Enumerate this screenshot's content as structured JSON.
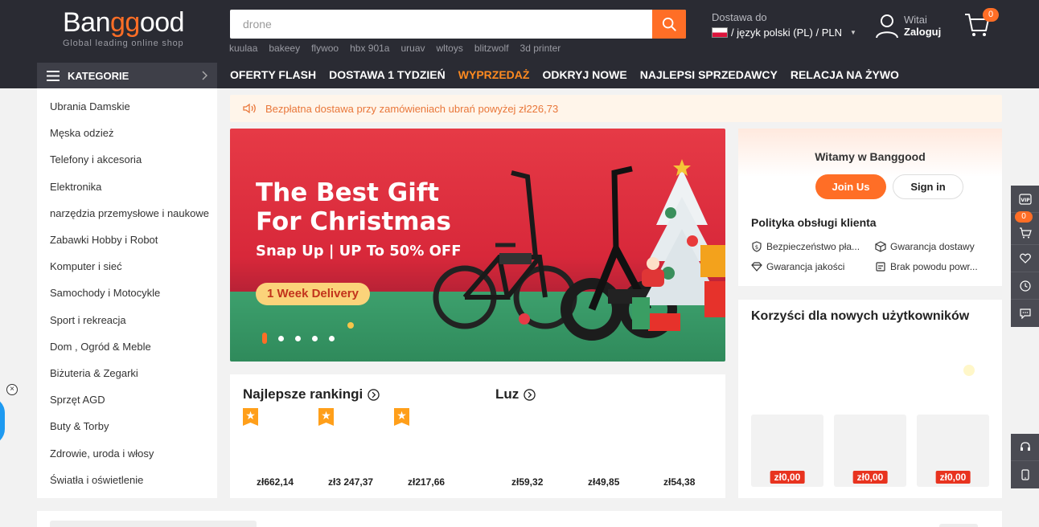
{
  "colors": {
    "brand": "#ff6e26",
    "header_bg": "#2a2b33",
    "price_tag": "#e8331f"
  },
  "logo": {
    "main_prefix": "Ban",
    "main_accent": "gg",
    "main_suffix": "ood",
    "tagline": "Global leading online shop"
  },
  "search": {
    "placeholder": "drone",
    "button_icon": "search-icon"
  },
  "hot_words": [
    "kuulaa",
    "bakeey",
    "flywoo",
    "hbx 901a",
    "uruav",
    "wltoys",
    "blitzwolf",
    "3d printer"
  ],
  "shipping": {
    "label": "Dostawa do",
    "value": "/ język polski (PL) / PLN"
  },
  "account": {
    "greeting": "Witai",
    "login": "Zaloguj"
  },
  "cart": {
    "count": "0"
  },
  "categories_button": "KATEGORIE",
  "nav": [
    "OFERTY FLASH",
    "DOSTAWA 1 TYDZIEŃ",
    "WYPRZEDAŻ",
    "ODKRYJ NOWE",
    "NAJLEPSI SPRZEDAWCY",
    "RELACJA NA ŻYWO"
  ],
  "categories": [
    "Ubrania Damskie",
    "Męska odzież",
    "Telefony i akcesoria",
    "Elektronika",
    "narzędzia przemysłowe i naukowe",
    "Zabawki Hobby i Robot",
    "Komputer i sieć",
    "Samochody i Motocykle",
    "Sport i rekreacja",
    "Dom , Ogród & Meble",
    "Biżuteria & Zegarki",
    "Sprzęt AGD",
    "Buty & Torby",
    "Zdrowie, uroda i włosy",
    "Światła i oświetlenie"
  ],
  "notice": "Bezpłatna dostawa przy zamówieniach ubrań powyżej zł226,73",
  "banner": {
    "title_line1": "The Best Gift",
    "title_line2": "For Christmas",
    "subtitle": "Snap Up | UP To 50% OFF",
    "pill": "1 Week Delivery",
    "slide_count": 5,
    "active_slide": 1
  },
  "rankings": {
    "title": "Najlepsze rankingi",
    "prices": [
      "zł662,14",
      "zł3 247,37",
      "zł217,66"
    ]
  },
  "luz": {
    "title": "Luz",
    "prices": [
      "zł59,32",
      "zł49,85",
      "zł54,38"
    ]
  },
  "welcome": {
    "title": "Witamy w Banggood",
    "join": "Join Us",
    "sign_in": "Sign in",
    "policy_title": "Polityka obsługi klienta",
    "policies": [
      "Bezpieczeństwo pła...",
      "Gwarancja dostawy",
      "Gwarancja jakości",
      "Brak powodu powr..."
    ]
  },
  "benefits": {
    "title": "Korzyści dla nowych użytkowników",
    "prices": [
      "zł0,00",
      "zł0,00",
      "zł0,00"
    ]
  },
  "floatbar": {
    "cart_count": "0"
  }
}
